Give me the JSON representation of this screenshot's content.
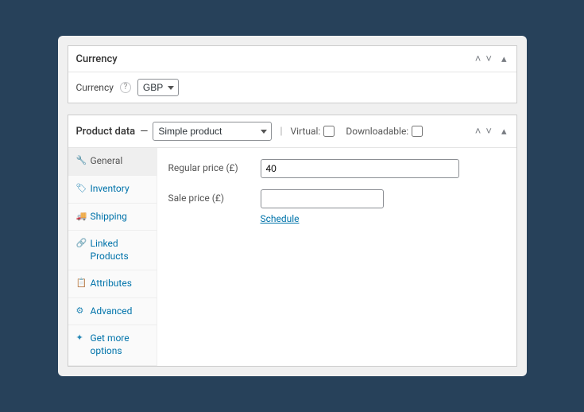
{
  "currency_box": {
    "title": "Currency",
    "label": "Currency",
    "selected": "GBP"
  },
  "product_data": {
    "title": "Product data",
    "type_selected": "Simple product",
    "virtual_label": "Virtual:",
    "downloadable_label": "Downloadable:",
    "tabs": {
      "general": "General",
      "inventory": "Inventory",
      "shipping": "Shipping",
      "linked": "Linked Products",
      "attributes": "Attributes",
      "advanced": "Advanced",
      "get_more": "Get more options"
    },
    "fields": {
      "regular_price_label": "Regular price (£)",
      "regular_price_value": "40",
      "sale_price_label": "Sale price (£)",
      "sale_price_value": "",
      "schedule_label": "Schedule"
    }
  }
}
